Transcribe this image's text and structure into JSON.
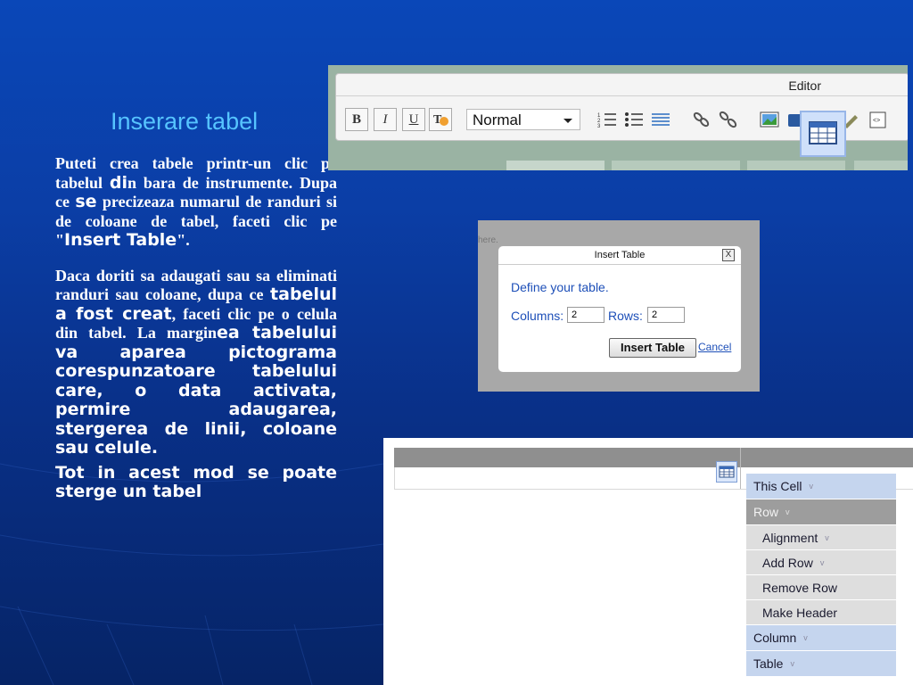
{
  "slide": {
    "title": "Inserare tabel",
    "paragraph1": {
      "a": "Puteti crea tabele printr-un clic pe tabelul ",
      "b": "di",
      "c": "n bara de instrumente. Dupa ce ",
      "d": "se",
      "e": " precizeaza numarul de randuri si de coloane de tabel, faceti clic pe \"",
      "f": "Insert Table",
      "g": "\"."
    },
    "paragraph2": {
      "a": "Daca doriti sa adaugati sau sa eliminati randuri sau coloane, dupa ce ",
      "b": "tabelul a fost creat",
      "c": ", faceti clic pe o celula din tabel. La margin",
      "d": "ea tabelului va aparea pictograma corespunzatoare tabelului care, o data activata, permire adaugarea, stergerea de linii, coloane sau celule."
    },
    "paragraph3": "Tot in acest mod se poate sterge un tabel"
  },
  "editor": {
    "title": "Editor",
    "bold": "B",
    "italic": "I",
    "underline": "U",
    "format_value": "Normal"
  },
  "dialog": {
    "faint_text": "here.",
    "title": "Insert Table",
    "close": "X",
    "prompt": "Define your table.",
    "columns_label": "Columns:",
    "columns_value": "2",
    "rows_label": "Rows:",
    "rows_value": "2",
    "ok_button": "Insert Table",
    "cancel_link": "Cancel"
  },
  "cell_menu": {
    "items": [
      {
        "label": "This Cell",
        "arrow": "v"
      },
      {
        "label": "Row",
        "arrow": "v"
      },
      {
        "label": "Alignment",
        "arrow": "v"
      },
      {
        "label": "Add Row",
        "arrow": "v"
      },
      {
        "label": "Remove Row",
        "arrow": ""
      },
      {
        "label": "Make Header",
        "arrow": ""
      },
      {
        "label": "Column",
        "arrow": "v"
      },
      {
        "label": "Table",
        "arrow": "v"
      }
    ]
  },
  "icons": [
    "bold-icon",
    "italic-icon",
    "underline-icon",
    "paste-format-icon",
    "numbered-list-icon",
    "bullet-list-icon",
    "indent-icon",
    "link-icon",
    "unlink-icon",
    "image-icon",
    "media-icon",
    "table-icon",
    "source-icon"
  ]
}
